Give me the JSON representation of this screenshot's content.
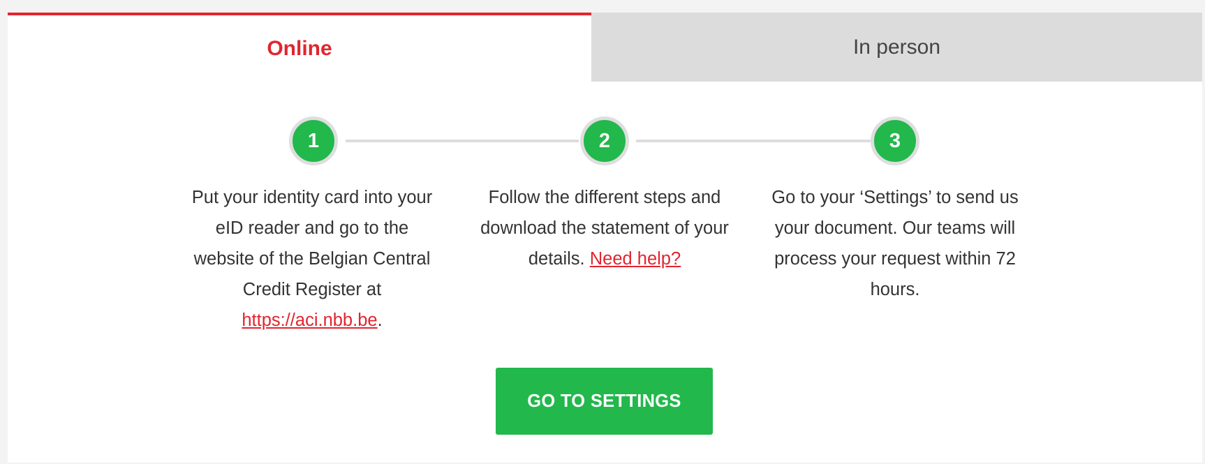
{
  "tabs": [
    {
      "label": "Online",
      "active": true
    },
    {
      "label": "In person",
      "active": false
    }
  ],
  "steps": [
    {
      "number": "1",
      "text_before": "Put your identity card into your eID reader and go to the website of the Belgian Central Credit Register at",
      "link": "https://aci.nbb.be",
      "text_after": "."
    },
    {
      "number": "2",
      "text_before": "Follow the different steps and download the statement of your details.",
      "link": "Need help?",
      "text_after": ""
    },
    {
      "number": "3",
      "text_before": "Go to your ‘Settings’ to send us your document. Our teams will process your request within 72 hours.",
      "link": "",
      "text_after": ""
    }
  ],
  "cta": {
    "label": "GO TO SETTINGS"
  },
  "colors": {
    "accent_red": "#e1252f",
    "step_green": "#22b84c",
    "inactive_tab_bg": "#dcdcdc"
  }
}
